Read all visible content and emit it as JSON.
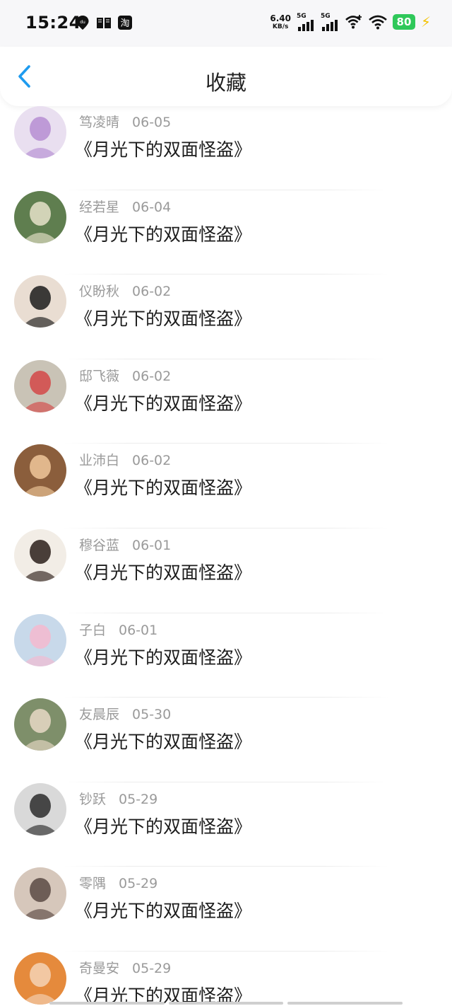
{
  "status_bar": {
    "time": "15:24",
    "icons_left": [
      "map-pin-icon",
      "book-icon",
      "taobao-icon"
    ],
    "net_speed_value": "6.40",
    "net_speed_unit": "KB/s",
    "signal_1_label": "5G",
    "signal_2_label": "5G",
    "battery": "80",
    "colors": {
      "battery": "#2fc85a",
      "bolt": "#f2c200"
    }
  },
  "header": {
    "title": "收藏",
    "back_icon": "chevron-left-icon",
    "accent": "#1e9bef"
  },
  "items": [
    {
      "name": "笃凌晴",
      "date": "06-05",
      "book": "《月光下的双面怪盗》",
      "avatar": "anime-angel-girl",
      "bg": "#e9dff0",
      "fg": "#b68ed2"
    },
    {
      "name": "经若星",
      "date": "06-04",
      "book": "《月光下的双面怪盗》",
      "avatar": "green-robot-figure",
      "bg": "#5f7e4f",
      "fg": "#e6e2c9"
    },
    {
      "name": "仪盼秋",
      "date": "06-02",
      "book": "《月光下的双面怪盗》",
      "avatar": "woman-black-hat",
      "bg": "#e9ddd2",
      "fg": "#1c1c1c"
    },
    {
      "name": "邸飞薇",
      "date": "06-02",
      "book": "《月光下的双面怪盗》",
      "avatar": "spin-class-women",
      "bg": "#c9c3b6",
      "fg": "#d44848"
    },
    {
      "name": "业沛白",
      "date": "06-02",
      "book": "《月光下的双面怪盗》",
      "avatar": "orange-cat",
      "bg": "#8b5e3c",
      "fg": "#f0c79a"
    },
    {
      "name": "穆谷蓝",
      "date": "06-01",
      "book": "《月光下的双面怪盗》",
      "avatar": "anime-man-officer-cap",
      "bg": "#f2ede6",
      "fg": "#2c1f1a"
    },
    {
      "name": "子白",
      "date": "06-01",
      "book": "《月光下的双面怪盗》",
      "avatar": "anime-pink-hair-girl",
      "bg": "#c8d9ea",
      "fg": "#f4b9cf"
    },
    {
      "name": "友晨辰",
      "date": "05-30",
      "book": "《月光下的双面怪盗》",
      "avatar": "girl-in-forest",
      "bg": "#7e8f6a",
      "fg": "#e8d9c5"
    },
    {
      "name": "钞跃",
      "date": "05-29",
      "book": "《月光下的双面怪盗》",
      "avatar": "bw-woman-portrait",
      "bg": "#d9d9d9",
      "fg": "#2b2b2b"
    },
    {
      "name": "零隅",
      "date": "05-29",
      "book": "《月光下的双面怪盗》",
      "avatar": "anime-masked-girl",
      "bg": "#d6c7bb",
      "fg": "#5a4a44"
    },
    {
      "name": "奇曼安",
      "date": "05-29",
      "book": "《月光下的双面怪盗》",
      "avatar": "red-hair-woman",
      "bg": "#e58a3c",
      "fg": "#f5d2b5"
    }
  ]
}
